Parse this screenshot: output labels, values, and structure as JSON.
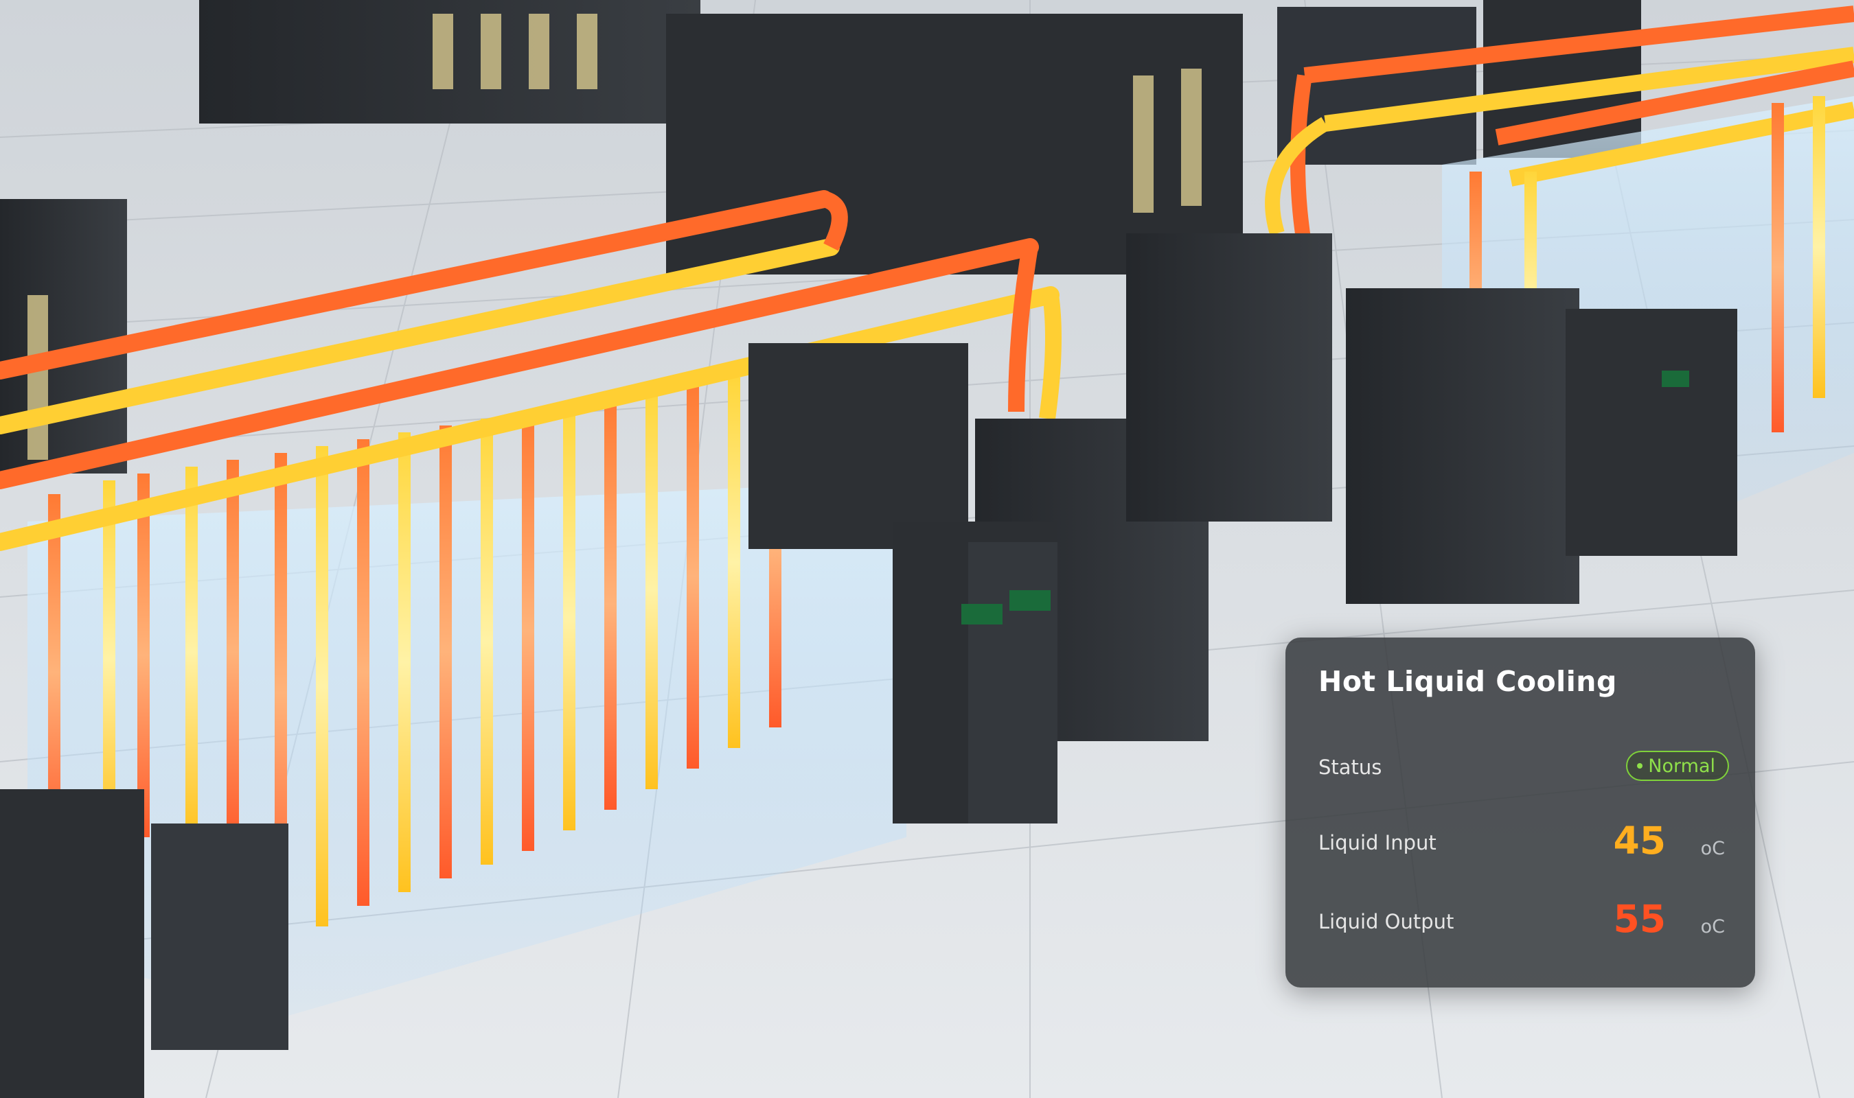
{
  "panel": {
    "title": "Hot Liquid Cooling",
    "status_label": "Status",
    "status_value": "Normal",
    "status_color": "#8fe04a",
    "input_label": "Liquid Input",
    "input_value": "45",
    "input_color": "#ffae1f",
    "output_label": "Liquid Output",
    "output_value": "55",
    "output_color": "#ff5122",
    "unit": "oC"
  },
  "colors": {
    "hot_pipe": "#ff6a2a",
    "warm_pipe": "#ffd43a",
    "cool_glow": "#bfe7ff",
    "cabinet": "#2f3236",
    "floor": "#d9dde1"
  }
}
